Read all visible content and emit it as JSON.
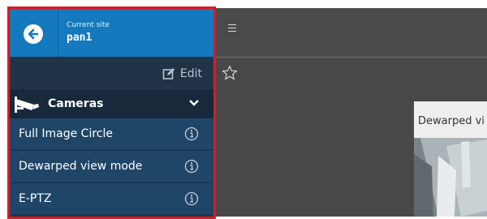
{
  "site": {
    "caption": "Current site",
    "name": "pan1"
  },
  "toolbar": {
    "edit_label": "Edit"
  },
  "section": {
    "label": "Cameras",
    "icon": "security-camera-icon"
  },
  "items": [
    {
      "label": "Full Image Circle",
      "icon": "info-icon"
    },
    {
      "label": "Dewarped view mode",
      "icon": "info-icon"
    },
    {
      "label": "E-PTZ",
      "icon": "info-icon"
    }
  ],
  "preview": {
    "title": "Dewarped vi"
  },
  "colors": {
    "header_blue": "#1479bd",
    "sidebar_dark": "#213447",
    "item_blue": "#1f4567",
    "highlight_red": "#e3161e",
    "content_gray": "#484848"
  }
}
